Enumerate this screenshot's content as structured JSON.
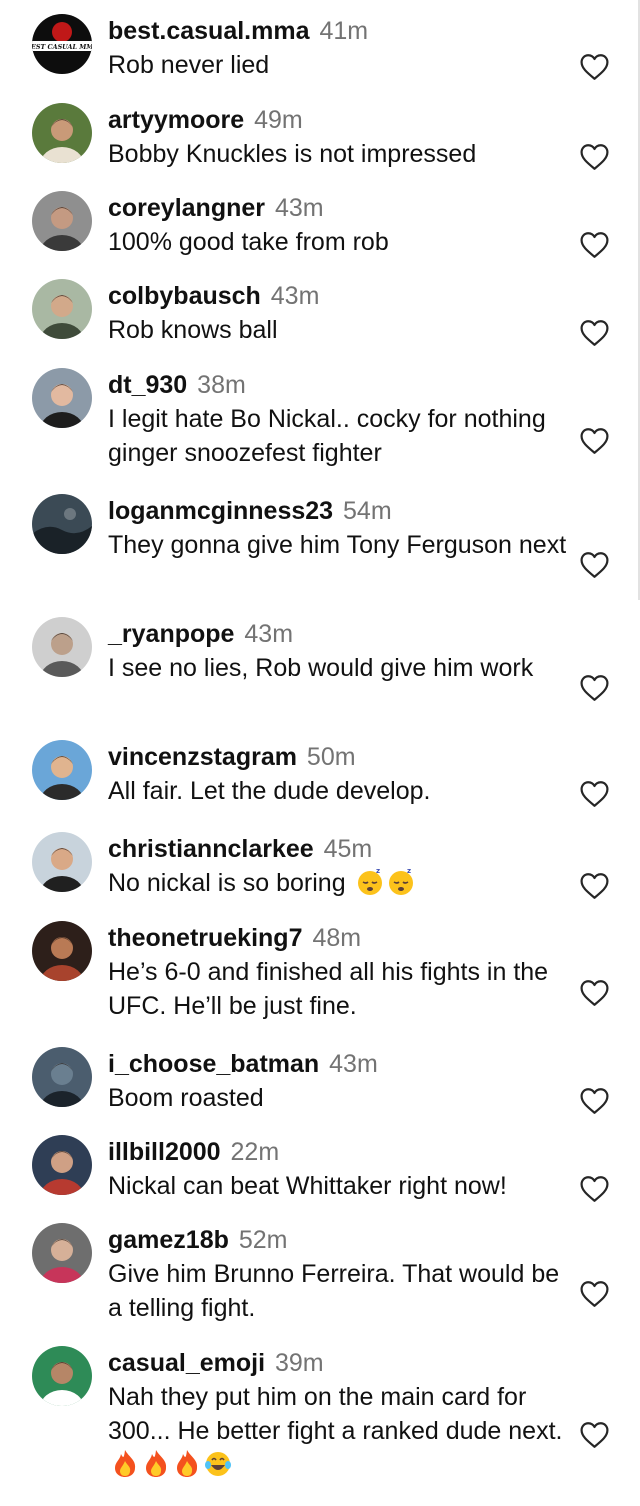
{
  "comments": [
    {
      "username": "best.casual.mma",
      "time": "41m",
      "text": "Rob never lied",
      "avatar": "logo-avatar",
      "logo_text": "BEST CASUAL MMA",
      "emojis": []
    },
    {
      "username": "artyymoore",
      "time": "49m",
      "text": "Bobby Knuckles is not impressed",
      "avatar": "photo-avatar",
      "emojis": []
    },
    {
      "username": "coreylangner",
      "time": "43m",
      "text": "100% good take from rob",
      "avatar": "photo-avatar",
      "emojis": []
    },
    {
      "username": "colbybausch",
      "time": "43m",
      "text": "Rob knows ball",
      "avatar": "photo-avatar",
      "emojis": []
    },
    {
      "username": "dt_930",
      "time": "38m",
      "text": "I legit hate Bo Nickal.. cocky for nothing ginger snoozefest fighter",
      "avatar": "photo-avatar",
      "emojis": []
    },
    {
      "username": "loganmcginness23",
      "time": "54m",
      "text": "They gonna give him Tony Ferguson next",
      "avatar": "photo-avatar",
      "emojis": []
    },
    {
      "username": "_ryanpope",
      "time": "43m",
      "text": "I see no lies, Rob would give him work",
      "avatar": "photo-avatar",
      "emojis": []
    },
    {
      "username": "vincenzstagram",
      "time": "50m",
      "text": "All fair. Let the dude develop.",
      "avatar": "photo-avatar",
      "emojis": []
    },
    {
      "username": "christiannclarkee",
      "time": "45m",
      "text": "No nickal is so boring",
      "avatar": "photo-avatar",
      "emojis": [
        "sleeping-face-emoji",
        "sleeping-face-emoji"
      ]
    },
    {
      "username": "theonetrueking7",
      "time": "48m",
      "text": "He’s 6-0 and finished all his fights in the UFC. He’ll be just fine.",
      "avatar": "photo-avatar",
      "emojis": []
    },
    {
      "username": "i_choose_batman",
      "time": "43m",
      "text": "Boom roasted",
      "avatar": "photo-avatar",
      "emojis": []
    },
    {
      "username": "illbill2000",
      "time": "22m",
      "text": "Nickal can beat Whittaker right now!",
      "avatar": "photo-avatar",
      "emojis": []
    },
    {
      "username": "gamez18b",
      "time": "52m",
      "text": "Give him Brunno Ferreira. That would be a telling fight.",
      "avatar": "photo-avatar",
      "emojis": []
    },
    {
      "username": "casual_emoji",
      "time": "39m",
      "text": "Nah they put him on the main card for 300... He better fight a ranked dude next.",
      "avatar": "photo-avatar",
      "emojis": [
        "fire-emoji",
        "fire-emoji",
        "fire-emoji",
        "tears-of-joy-emoji"
      ]
    }
  ],
  "icons": {
    "like": "heart-outline-icon"
  },
  "colors": {
    "text": "#111111",
    "timestamp": "#737373",
    "heart": "#262626",
    "background": "#ffffff"
  }
}
